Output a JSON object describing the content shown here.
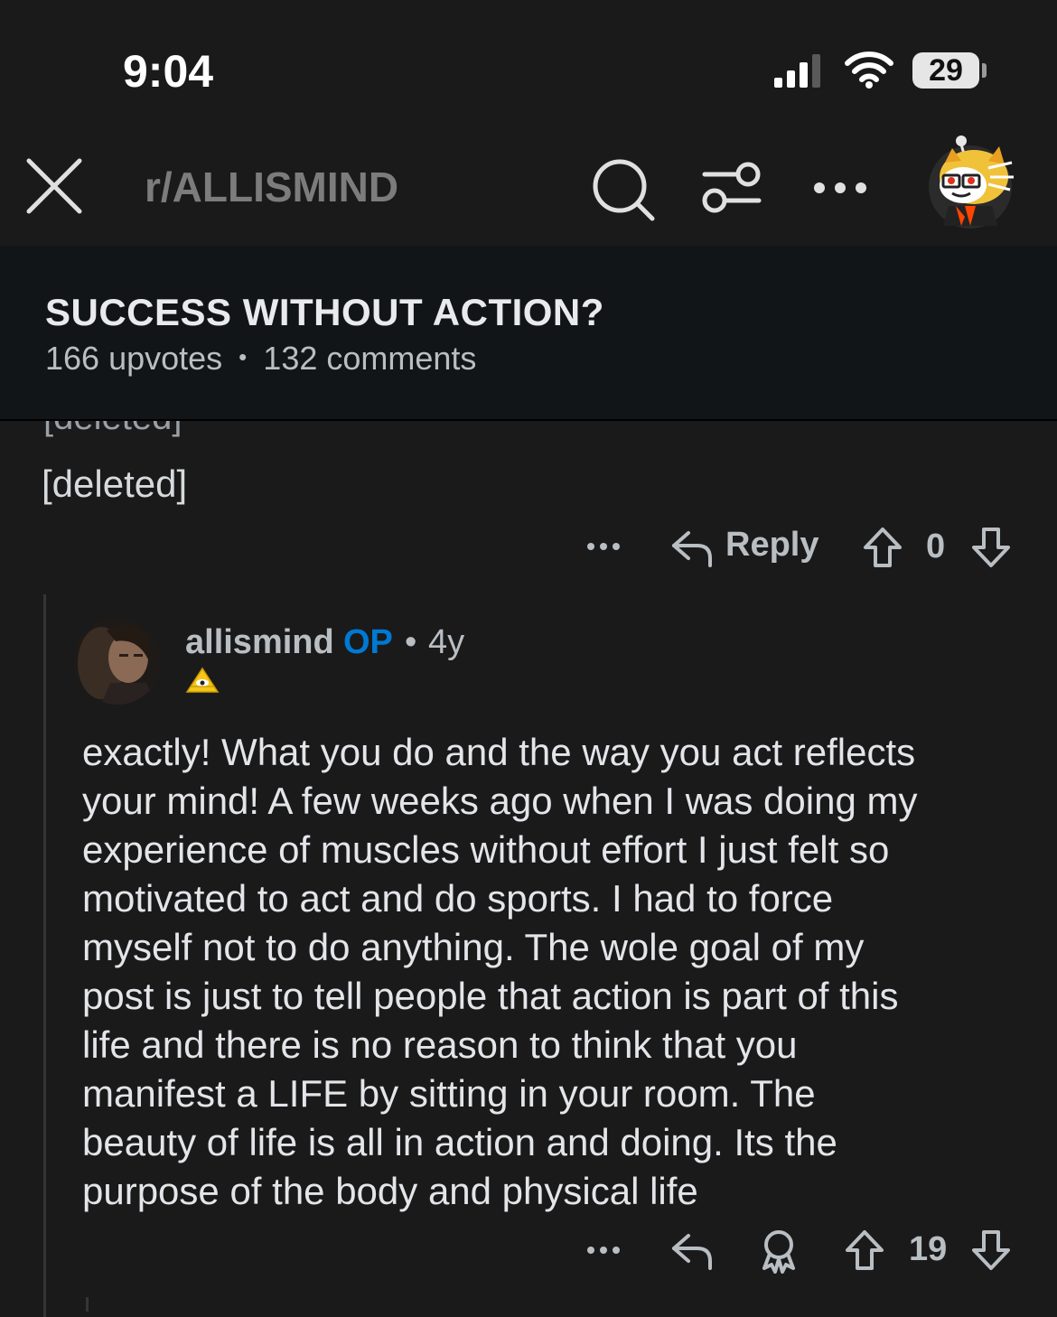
{
  "status_bar": {
    "time": "9:04",
    "battery": "29"
  },
  "nav": {
    "subreddit": "r/ALLISMIND",
    "icons": [
      "close-icon",
      "search-icon",
      "filter-icon",
      "more-icon",
      "avatar-icon"
    ]
  },
  "post": {
    "title": "SUCCESS WITHOUT ACTION?",
    "upvotes": "166 upvotes",
    "separator": "•",
    "comments": "132 comments"
  },
  "parent_comment": {
    "author_cut": "[deleted]",
    "body": "[deleted]",
    "reply_label": "Reply",
    "score": "0"
  },
  "reply_comment": {
    "author": "allismind",
    "op_badge": "OP",
    "separator": "•",
    "age": "4y",
    "body_lines": [
      "exactly! What you do and the way you act reflects",
      "your mind! A few weeks ago when I was doing my",
      "experience of muscles without effort I just felt so",
      "motivated to act and do sports. I had to force",
      "myself not to do anything. The wole goal of my",
      "post is just to tell people that action is part of this",
      "life and there is no reason to think that you",
      "manifest a LIFE by sitting in your room. The",
      "beauty of life is all in action and doing. Its the",
      "purpose of the body and physical life"
    ],
    "score": "19"
  },
  "colors": {
    "background": "#1a1a1b",
    "header_bg": "#121518",
    "op_blue": "#0079d3",
    "muted_text": "#b9bec3"
  }
}
